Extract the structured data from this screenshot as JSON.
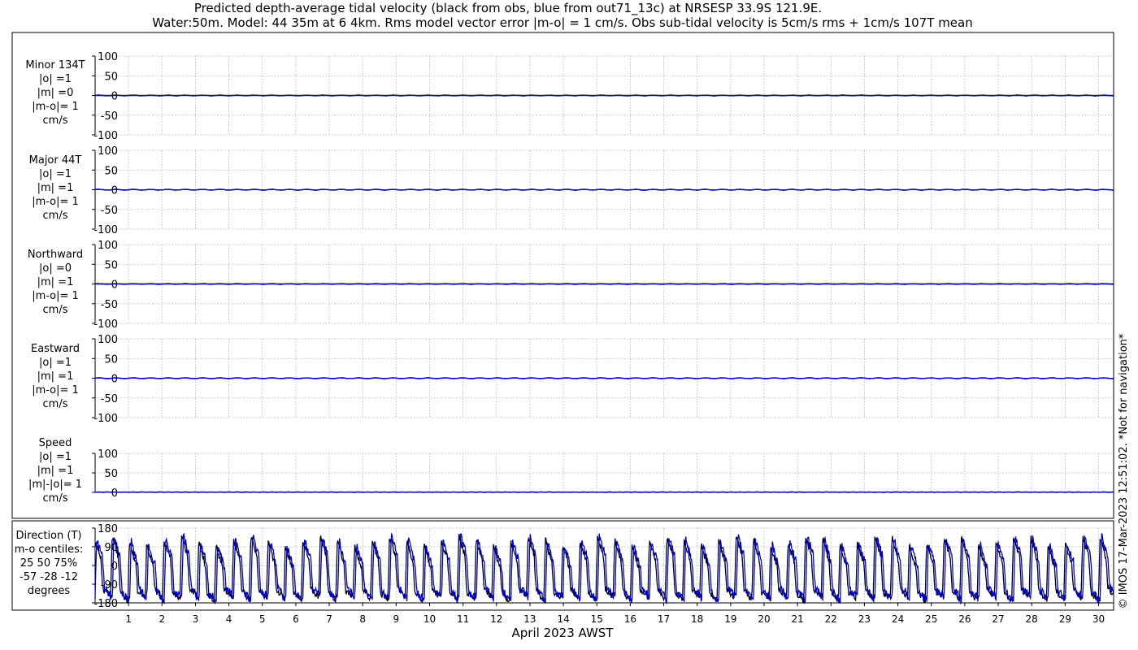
{
  "header": {
    "title_line1": "Predicted depth-average tidal velocity (black from obs, blue from out71_13c) at NRSESP 33.9S 121.9E.",
    "title_line2": "Water:50m. Model: 44 35m at 6 4km. Rms model vector error |m-o| = 1 cm/s. Obs sub-tidal velocity is 5cm/s rms + 1cm/s 107T mean"
  },
  "footer": {
    "x_label": "April 2023 AWST",
    "credit": "© IMOS 17-Mar-2023 12:51:02. *Not for navigation*"
  },
  "colors": {
    "obs": "#000000",
    "model": "#0000cc",
    "grid": "#b0b0b0"
  },
  "chart_data": {
    "type": "line",
    "x_axis": {
      "label": "April 2023 AWST",
      "range_days": [
        0,
        30.45
      ],
      "ticks": [
        1,
        2,
        3,
        4,
        5,
        6,
        7,
        8,
        9,
        10,
        11,
        12,
        13,
        14,
        15,
        16,
        17,
        18,
        19,
        20,
        21,
        22,
        23,
        24,
        25,
        26,
        27,
        28,
        29,
        30
      ]
    },
    "series_legend": [
      {
        "name": "obs",
        "color": "#000000"
      },
      {
        "name": "out71_13c",
        "color": "#0000cc"
      }
    ],
    "panels": [
      {
        "id": "minor",
        "label_lines": [
          "Minor 134T",
          "|o| =1",
          "|m| =0",
          "|m-o|= 1",
          "cm/s"
        ],
        "ylim": [
          -100,
          100
        ],
        "yticks": [
          100,
          50,
          0,
          -50,
          -100
        ],
        "amplitude_obs": 1,
        "amplitude_model": 0
      },
      {
        "id": "major",
        "label_lines": [
          "Major 44T",
          "|o| =1",
          "|m| =1",
          "|m-o|= 1",
          "cm/s"
        ],
        "ylim": [
          -100,
          100
        ],
        "yticks": [
          100,
          50,
          0,
          -50,
          -100
        ],
        "amplitude_obs": 1,
        "amplitude_model": 1
      },
      {
        "id": "north",
        "label_lines": [
          "Northward",
          "|o| =0",
          "|m| =1",
          "|m-o|= 1",
          "cm/s"
        ],
        "ylim": [
          -100,
          100
        ],
        "yticks": [
          100,
          50,
          0,
          -50,
          -100
        ],
        "amplitude_obs": 0,
        "amplitude_model": 1
      },
      {
        "id": "east",
        "label_lines": [
          "Eastward",
          "|o| =1",
          "|m| =1",
          "|m-o|= 1",
          "cm/s"
        ],
        "ylim": [
          -100,
          100
        ],
        "yticks": [
          100,
          50,
          0,
          -50,
          -100
        ],
        "amplitude_obs": 1,
        "amplitude_model": 1
      },
      {
        "id": "speed",
        "label_lines": [
          "Speed",
          "|o| =1",
          "|m| =1",
          "|m|-|o|= 1",
          "cm/s"
        ],
        "ylim": [
          0,
          100
        ],
        "yticks": [
          100,
          50,
          0
        ],
        "amplitude_obs": 1,
        "amplitude_model": 1
      },
      {
        "id": "direction",
        "label_lines": [
          "Direction (T)",
          "m-o centiles:",
          "25  50  75%",
          "-57 -28 -12",
          "degrees"
        ],
        "ylim": [
          -180,
          180
        ],
        "yticks": [
          180,
          90,
          0,
          -90,
          -180
        ]
      }
    ]
  }
}
